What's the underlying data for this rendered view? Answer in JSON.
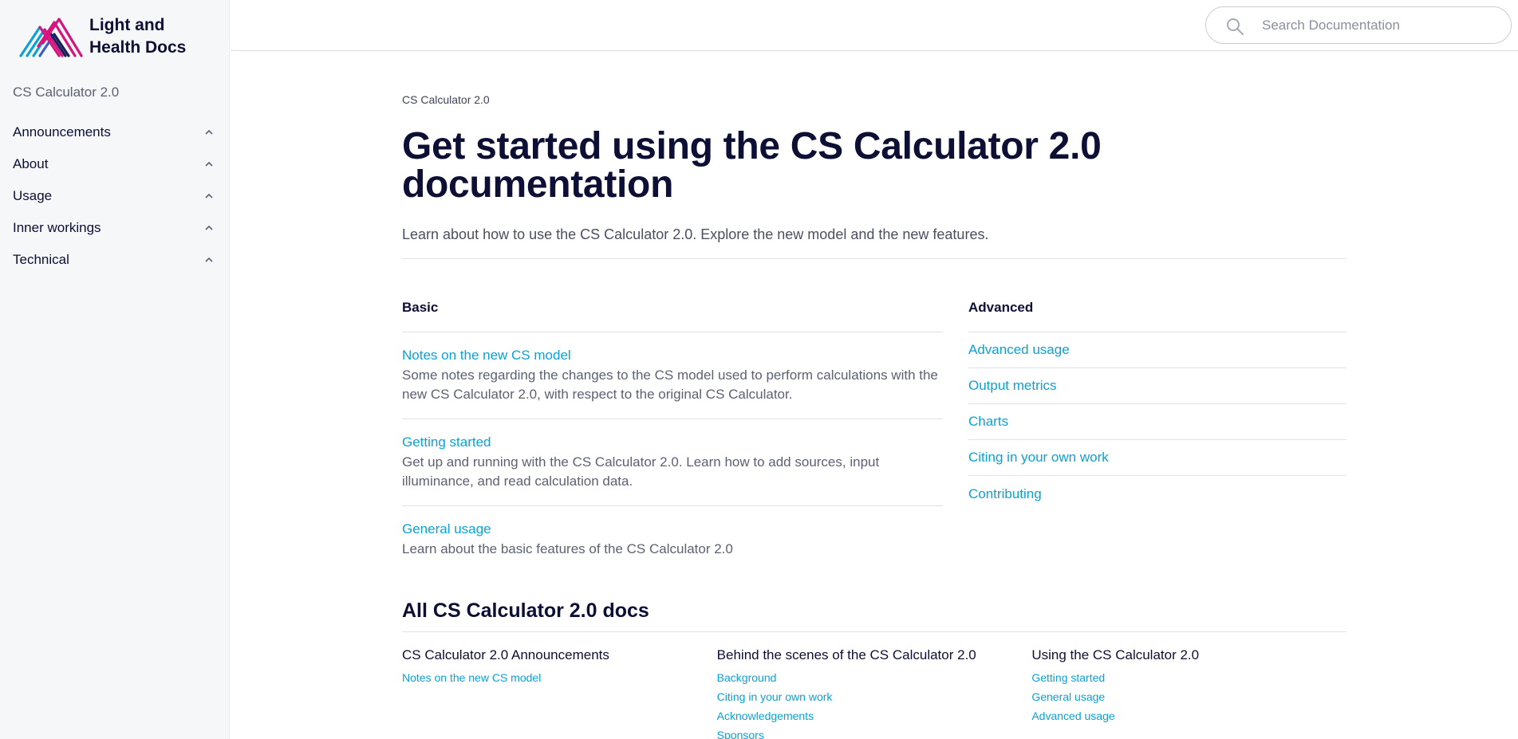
{
  "brand": {
    "logo_line1": "Light and",
    "logo_line2": "Health Docs",
    "colors": {
      "accent": "#0aa2d8",
      "navy": "#0d0f35",
      "magenta": "#d6157f",
      "sidebar_bg": "#f6f7f9"
    }
  },
  "search": {
    "placeholder": "Search Documentation",
    "icon": "search-icon"
  },
  "sidebar": {
    "root": "CS Calculator 2.0",
    "items": [
      {
        "label": "Announcements",
        "icon": "chevron-up-icon"
      },
      {
        "label": "About",
        "icon": "chevron-up-icon"
      },
      {
        "label": "Usage",
        "icon": "chevron-up-icon"
      },
      {
        "label": "Inner workings",
        "icon": "chevron-up-icon"
      },
      {
        "label": "Technical",
        "icon": "chevron-up-icon"
      }
    ]
  },
  "main": {
    "breadcrumb": "CS Calculator 2.0",
    "title": "Get started using the CS Calculator 2.0 documentation",
    "lead": "Learn about how to use the CS Calculator 2.0. Explore the new model and the new features.",
    "basic": {
      "heading": "Basic",
      "items": [
        {
          "title": "Notes on the new CS model",
          "desc": "Some notes regarding the changes to the CS model used to perform calculations with the new CS Calculator 2.0, with respect to the original CS Calculator."
        },
        {
          "title": "Getting started",
          "desc": "Get up and running with the CS Calculator 2.0. Learn how to add sources, input illuminance, and read calculation data."
        },
        {
          "title": "General usage",
          "desc": "Learn about the basic features of the CS Calculator 2.0"
        }
      ]
    },
    "advanced": {
      "heading": "Advanced",
      "items": [
        "Advanced usage",
        "Output metrics",
        "Charts",
        "Citing in your own work",
        "Contributing"
      ]
    },
    "all_docs": {
      "heading": "All CS Calculator 2.0 docs",
      "categories": [
        {
          "title": "CS Calculator 2.0 Announcements",
          "links": [
            "Notes on the new CS model"
          ]
        },
        {
          "title": "Behind the scenes of the CS Calculator 2.0",
          "links": [
            "Background",
            "Citing in your own work",
            "Acknowledgements",
            "Sponsors"
          ]
        },
        {
          "title": "Using the CS Calculator 2.0",
          "links": [
            "Getting started",
            "General usage",
            "Advanced usage"
          ]
        }
      ]
    }
  }
}
